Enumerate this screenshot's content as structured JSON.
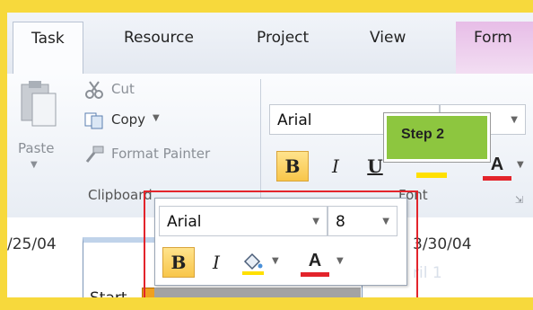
{
  "tabs": [
    "Task",
    "Resource",
    "Project",
    "View",
    "Form"
  ],
  "clipboard": {
    "paste": "Paste",
    "cut": "Cut",
    "copy": "Copy",
    "format_painter": "Format Painter",
    "group_label": "Clipboard"
  },
  "font": {
    "name": "Arial",
    "size": "8",
    "bold": "B",
    "italic": "I",
    "underline": "U",
    "color_letter": "A",
    "group_label": "Font"
  },
  "callout": {
    "label": "Step 2"
  },
  "timeline": {
    "date_left": "/25/04",
    "date_right": "3/30/04",
    "start_label": "Start",
    "faint_text": "ril 1"
  },
  "mini_toolbar": {
    "font_name": "Arial",
    "font_size": "8",
    "bold": "B",
    "italic": "I",
    "color_letter": "A"
  },
  "colors": {
    "highlight_red": "#e3242b",
    "step_green": "#8dc63f",
    "bold_active": "#f8c64a",
    "frame_yellow": "#f7d93c"
  }
}
